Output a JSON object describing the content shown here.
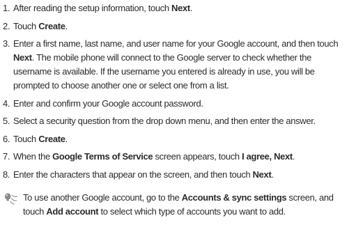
{
  "steps": [
    {
      "num": "1.",
      "parts": [
        {
          "t": "After reading the setup information, touch "
        },
        {
          "t": "Next",
          "b": true
        },
        {
          "t": "."
        }
      ]
    },
    {
      "num": "2.",
      "parts": [
        {
          "t": "Touch "
        },
        {
          "t": "Create",
          "b": true
        },
        {
          "t": "."
        }
      ]
    },
    {
      "num": "3.",
      "parts": [
        {
          "t": "Enter a first name, last name, and user name for your Google account, and then touch "
        },
        {
          "t": "Next",
          "b": true
        },
        {
          "t": ". The mobile phone will connect to the Google server to check whether the username is available. If the username you entered is already in use, you will be prompted to choose another one or select one from a list."
        }
      ]
    },
    {
      "num": "4.",
      "parts": [
        {
          "t": "Enter and confirm your Google account password."
        }
      ]
    },
    {
      "num": "5.",
      "parts": [
        {
          "t": "Select a security question from the drop down menu, and then enter the answer."
        }
      ]
    },
    {
      "num": "6.",
      "parts": [
        {
          "t": "Touch "
        },
        {
          "t": "Create",
          "b": true
        },
        {
          "t": "."
        }
      ]
    },
    {
      "num": "7.",
      "parts": [
        {
          "t": "When the "
        },
        {
          "t": "Google Terms of Service",
          "b": true
        },
        {
          "t": " screen appears, touch "
        },
        {
          "t": "I agree, Next",
          "b": true
        },
        {
          "t": "."
        }
      ]
    },
    {
      "num": "8.",
      "parts": [
        {
          "t": "Enter the characters that appear on the screen, and then touch "
        },
        {
          "t": "Next",
          "b": true
        },
        {
          "t": "."
        }
      ]
    }
  ],
  "tip": {
    "icon": "tip-icon",
    "parts": [
      {
        "t": "To use another Google account, go to the "
      },
      {
        "t": "Accounts & sync settings",
        "b": true
      },
      {
        "t": " screen, and touch "
      },
      {
        "t": "Add account",
        "b": true
      },
      {
        "t": " to select which type of accounts you want to add."
      }
    ]
  }
}
